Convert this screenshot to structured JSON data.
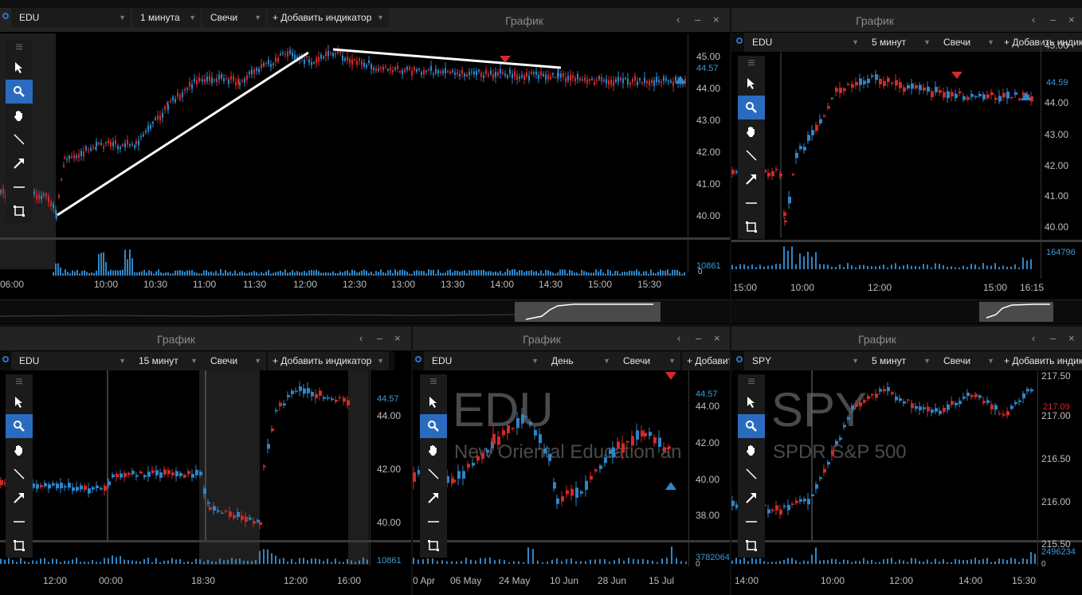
{
  "colors": {
    "up": "#2e86c9",
    "down": "#d22a2a",
    "accent": "#2a6bc0"
  },
  "windows": {
    "main": {
      "title": "",
      "symbol": "EDU",
      "interval": "1 минута",
      "type": "Свечи",
      "add": "+ Добавить индикатор",
      "price_current": "44.57",
      "volume_current": "10861",
      "volume_zero": "0",
      "yticks": [
        "45.00",
        "44.00",
        "43.00",
        "42.00",
        "41.00",
        "40.00"
      ],
      "xticks": [
        "06:00",
        "10:00",
        "10:30",
        "11:00",
        "11:30",
        "12:00",
        "12:30",
        "13:00",
        "13:30",
        "14:00",
        "14:30",
        "15:00",
        "15:30"
      ]
    },
    "topright": {
      "title": "График",
      "symbol": "EDU",
      "interval": "5 минут",
      "type": "Свечи",
      "add": "+ Добавить индикатор",
      "price_current": "44.59",
      "volume_current": "164796",
      "yticks": [
        "45.00",
        "44.00",
        "43.00",
        "42.00",
        "41.00",
        "40.00"
      ],
      "xticks": [
        "15:00",
        "10:00",
        "12:00",
        "15:00",
        "16:15"
      ]
    },
    "bottomleft": {
      "title": "График",
      "symbol": "EDU",
      "interval": "15 минут",
      "type": "Свечи",
      "add": "+ Добавить индикатор",
      "price_current": "44.57",
      "volume_current": "10861",
      "yticks": [
        "44.00",
        "42.00",
        "40.00"
      ],
      "xticks": [
        "12:00",
        "00:00",
        "18:30",
        "12:00",
        "16:00"
      ]
    },
    "bottommid": {
      "title": "График",
      "symbol": "EDU",
      "interval": "День",
      "type": "Свечи",
      "add": "+ Добавить",
      "price_current": "44.57",
      "volume_current": "3782064",
      "volume_zero": "0",
      "watermark": "EDU",
      "watermark_sub": "New Oriental Education an",
      "yticks": [
        "44.00",
        "42.00",
        "40.00",
        "38.00"
      ],
      "xticks": [
        "0 Apr",
        "06 May",
        "24 May",
        "10 Jun",
        "28 Jun",
        "15 Jul"
      ]
    },
    "bottomright": {
      "title": "График",
      "symbol": "SPY",
      "interval": "5 минут",
      "type": "Свечи",
      "add": "+ Добавить индикатор",
      "price_current": "217.09",
      "volume_current": "2496234",
      "volume_zero": "0",
      "watermark": "SPY",
      "watermark_sub": "SPDR S&P 500",
      "yticks": [
        "217.50",
        "217.00",
        "216.50",
        "216.00",
        "215.50"
      ],
      "xticks": [
        "14:00",
        "10:00",
        "12:00",
        "14:00",
        "15:30"
      ]
    }
  },
  "controls": {
    "back": "‹",
    "minimize": "–",
    "close": "×",
    "drag": "≡"
  },
  "tools": [
    "cursor-icon",
    "zoom-icon",
    "hand-icon",
    "line-icon",
    "arrow-icon",
    "hline-icon",
    "rect-icon"
  ]
}
